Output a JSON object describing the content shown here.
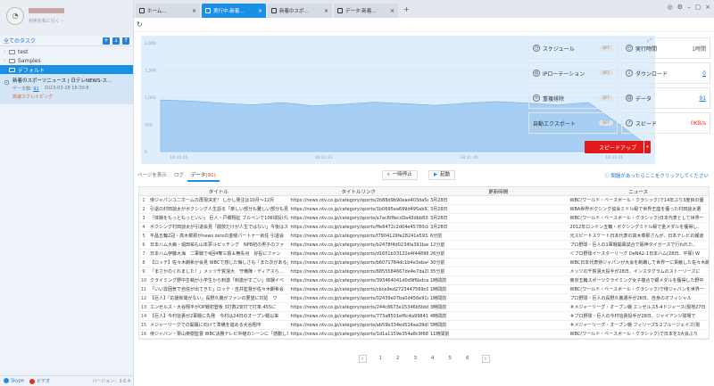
{
  "sidebar": {
    "subtitle": "利用を私に行く ›",
    "header_title": "全てのタスク",
    "tree": [
      {
        "label": "test"
      },
      {
        "label": "Samples"
      },
      {
        "label": "デフォルト"
      }
    ],
    "task": {
      "name": "新着のスポーツニュース | 日テレNEWS-ス...",
      "count_label": "データ数:",
      "count": "91",
      "time": "2023-03-28 18:30:8",
      "status": "高速スクレイピング"
    },
    "footer": {
      "skype": "Skype",
      "bizuseful": "ビデオ",
      "version": "バージョン：3.6.4"
    }
  },
  "tabs": [
    {
      "label": "ホーム..."
    },
    {
      "label": "実行中:新着..."
    },
    {
      "label": "新着のスポ..."
    },
    {
      "label": "データ:新着..."
    }
  ],
  "chart_data": {
    "type": "area",
    "y_ticks": [
      "2,000",
      "1,500",
      "1,000",
      "500",
      "0"
    ],
    "x_ticks": [
      "18:31:26",
      "18:31:31",
      "18:31:36",
      "18:31:41"
    ],
    "ylim": [
      0,
      2000
    ],
    "x": [
      0,
      1,
      2,
      3,
      4,
      5,
      6,
      7,
      8,
      9,
      10,
      11,
      12,
      13,
      14,
      15,
      16
    ],
    "values": [
      950,
      930,
      890,
      860,
      900,
      840,
      870,
      910,
      880,
      850,
      890,
      920,
      890,
      860,
      900,
      500,
      80
    ],
    "color": "#9dc9f2"
  },
  "panel": {
    "schedule": "スケジュール",
    "schedule_state": "OFF",
    "runtime": "実行時間",
    "runtime_val": "1時間",
    "ip": "IPローテーション",
    "ip_state": "OFF",
    "download": "ダウンロード",
    "download_val": "0",
    "dedup": "重複排除",
    "dedup_state": "OFF",
    "data": "データ",
    "data_val": "91",
    "autoexport": "自動エクスポート",
    "autoexport_state": "OFF",
    "speed": "スピード",
    "speed_val": "0KB/s",
    "speedup": "スピードアップ"
  },
  "subbar": {
    "page_view": "ページを表示",
    "log": "ログ",
    "data_tab": "データ",
    "data_count": "(91)",
    "pause": "一時停止",
    "start": "起動",
    "help": "問題があったらここをクリックしてください"
  },
  "table": {
    "headers": [
      "タイトル",
      "タイトルリンク",
      "更新時間",
      "ニュース"
    ],
    "rows": [
      [
        "1",
        "侍ジャパンユニホームの再現決定！ しかし発注は10月～12月",
        "https://news.ntv.co.jp/category/sports/2b88d9b90eae403da5e678...",
        "3月28日",
        "WBC(ワールド・ベースボール・クラシック)で14年ぶり3度目の優"
      ],
      [
        "2",
        "引退の村田諒太がボクシング人生語る「楽しい部分も難しい部分も見",
        "https://news.ntv.co.jp/category/sports/1b0695ea699d495ab91f99...",
        "3月28日",
        "WBA世界ボクシング協会ミドル級で世界王座を獲った村田諒太選"
      ],
      [
        "3",
        "「体験をもっともっといい」 巨人・戸郷翔征 ブルペンで106球投げ込",
        "https://news.ntv.co.jp/category/sports/a7ac6f8ecd3a43dbb83be8e...",
        "3月28日",
        "WBC(ワールド・ベースボール・クラシック)日本代表として世界一"
      ],
      [
        "4",
        "ボクシング村田諒太が引退会見「闘技だけが人生ではない」今後はス",
        "https://news.ntv.co.jp/category/sports/ffe6472c2d04e45780cbc2e...",
        "3月28日",
        "2012年ロンドン五輪・ボクシングミドル級で金メダルを獲得し、"
      ],
      [
        "5",
        "平昌五輪2冠・高木菜那がnews zeroの金曜パートナー就任 引退会",
        "https://news.ntv.co.jp/category/sports/f7904129fe28241e5932d46...",
        "6分前",
        "元スピードスケート日本代表の高木菜那さんが、日本テレビの報道"
      ],
      [
        "6",
        "日本ハム大嶋・堀田祐も山本夢斗ピッチング　NPB初の男子のファ",
        "https://news.ntv.co.jp/category/sports/b2478f4d0234fa391bace62...",
        "12分前",
        "プロ野球・巨人の1軍戦開幕試合で阪神タイガースで行われた、"
      ],
      [
        "7",
        "日本ハム伊藤大海　二軍戦で4回4奪三振＆無失点　好投にファン",
        "https://news.ntv.co.jp/category/sports/d1651b33122e4f44896156f...",
        "26分前",
        "＜プロ野球イースターリーグ DeNA2-1日本ハム(28日、平塚) W"
      ],
      [
        "8",
        "【ロッテ】佐々木朗希が会見 WBCで感じた悔しさも「また次がある」(",
        "https://news.ntv.co.jp/category/sports/b6071784dc1b4e3eba4148...",
        "30分前",
        "WBC日本代表侍ジャパンが大会を制覇して世界一に貢献した佐々木朗"
      ],
      [
        "9",
        "「まさかのくれました！」メッツ千賀滉大　守備陣・ディアスら...",
        "https://news.ntv.co.jp/category/sports/6855584667de4e7da20211...",
        "35分前",
        "メッツの千賀滉大投手が28日、インスタグラムのストーリーズに"
      ],
      [
        "10",
        "クライミング野中生萌が小学生から刺激「刺激がすごい」体験イベ",
        "https://news.ntv.co.jp/category/sports/393464041d0d9f6bdca98d...",
        "1時間前",
        "東京五輪スポーツクライミング女子複合で銀メダルを獲得した野中"
      ],
      [
        "11",
        "「いい雰囲気で自信が出てきた」ロッテ・吉井監督が佐々木朗希会",
        "https://news.ntv.co.jp/category/sports/cbce9ed2723447569c0e195...",
        "1時間前",
        "WBC(ワールド・ベースボール・クラシック)で侍ジャパンを世界一"
      ],
      [
        "12",
        "【巨人】「応援新聞がない」長野久義がファンの要望に対処　ワ",
        "https://news.ntv.co.jp/category/sports/02439e07ba0d456e91c2c49...",
        "1時間前",
        "プロ野球・巨人の長野久義選手が28日、自身のオフィシャル"
      ],
      [
        "13",
        "エンゼルス・大谷翔平がOP戦初登板 3打数2安打で打率.455に",
        "https://news.ntv.co.jp/category/sports/244c8673e15346b5bb8e1157...",
        "3時間前",
        "＃メジャーリーグ・オープン戦 エンゼルス5-4ドジャース(現地27日"
      ],
      [
        "14",
        "【巨人】今村信貴が2軍戦に先発　今村は24日のオープン戦以来",
        "https://news.ntv.co.jp/category/sports/773a8501ef6c4a99841d6aa...",
        "4時間前",
        "＃プロ野球・巨人の今村信貴投手が28日、ジャイアンツ球場で"
      ],
      [
        "15",
        "メジャーリーグでの開幕に向けて準備を進める大谷翔平",
        "https://news.ntv.co.jp/category/sports/ab59b334ed524aa39d9633...",
        "5時間前",
        "＃メジャーリーグ・オープン戦 フィリーズ5-2ブルージェイズ(現"
      ],
      [
        "16",
        "侍ジャパン・栗山英樹監督 WBC決勝テレビ中継のシーンに「感動した」",
        "https://news.ntv.co.jp/category/sports/1d1a1159e354a8c9f682e8...",
        "11時間前",
        "WBC(ワールド・ベースボール・クラシック)で日本を3大会ぶり"
      ]
    ]
  },
  "pager": {
    "pages": [
      "1",
      "2",
      "3",
      "4",
      "5",
      "6"
    ],
    "prev": "‹",
    "next": "›"
  }
}
